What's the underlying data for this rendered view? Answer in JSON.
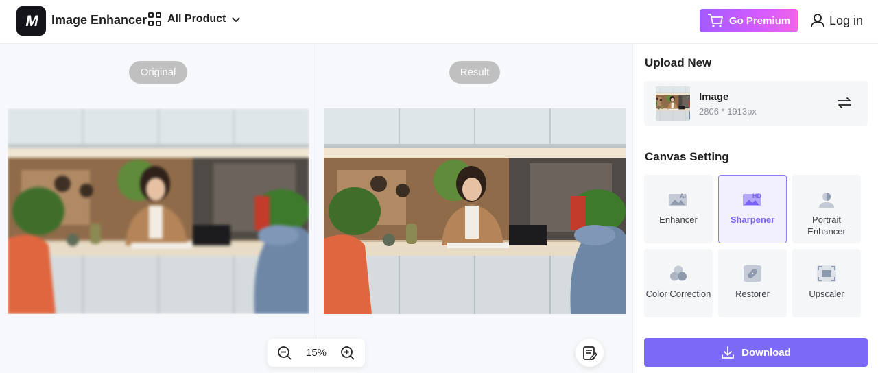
{
  "header": {
    "app_title": "Image Enhancer",
    "logo_text": "M",
    "all_product_label": "All Product",
    "premium_label": "Go Premium",
    "login_label": "Log in"
  },
  "canvas": {
    "original_label": "Original",
    "result_label": "Result",
    "zoom_value": "15%"
  },
  "side": {
    "upload_title": "Upload New",
    "image_name": "Image",
    "image_size": "2806 * 1913px",
    "canvas_title": "Canvas Setting",
    "tools": [
      {
        "label": "Enhancer",
        "icon": "ai-image-icon",
        "active": false
      },
      {
        "label": "Sharpener",
        "icon": "hd-image-icon",
        "active": true
      },
      {
        "label": "Portrait Enhancer",
        "icon": "portrait-icon",
        "active": false
      },
      {
        "label": "Color Correction",
        "icon": "color-circles-icon",
        "active": false
      },
      {
        "label": "Restorer",
        "icon": "bandage-icon",
        "active": false
      },
      {
        "label": "Upscaler",
        "icon": "upscale-frame-icon",
        "active": false
      }
    ],
    "download_label": "Download"
  },
  "colors": {
    "accent": "#7a6af6",
    "premium_gradient_start": "#a35cff",
    "premium_gradient_end": "#ef64e9",
    "pill_gray": "#c0c0c0",
    "canvas_bg": "#f6f8fb"
  }
}
